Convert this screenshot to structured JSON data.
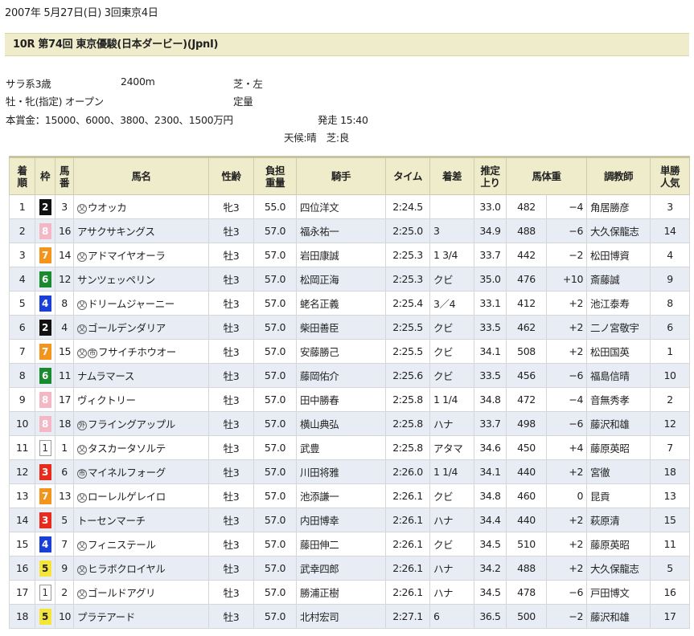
{
  "header": {
    "date": "2007年 5月27日(日) 3回東京4日",
    "race_title": "10R 第74回 東京優駿(日本ダービー)(JpnI)"
  },
  "info": {
    "category": "サラ系3歳",
    "distance": "2400m",
    "surface": "芝・左",
    "conditions": "牡・牝(指定) オープン",
    "weight_rule": "定量",
    "prize": "本賞金：15000、6000、3800、2300、1500万円",
    "post_time": "発走 15:40",
    "weather": "天候:晴　芝:良"
  },
  "table": {
    "headers": {
      "rank": "着\n順",
      "waku": "枠",
      "umaban": "馬\n番",
      "name": "馬名",
      "sexage": "性齢",
      "weight": "負担\n重量",
      "jockey": "騎手",
      "time": "タイム",
      "margin": "着差",
      "last3f": "推定\n上り",
      "body": "馬体重",
      "trainer": "調教師",
      "pop": "単勝\n人気"
    },
    "rows": [
      {
        "rank": "1",
        "waku": "2",
        "umaban": "3",
        "marks": [
          "父"
        ],
        "name": "ウオッカ",
        "sexage": "牝3",
        "weight": "55.0",
        "jockey": "四位洋文",
        "time": "2:24.5",
        "margin": "",
        "last3f": "33.0",
        "bw": "482",
        "bwd": "−4",
        "trainer": "角居勝彦",
        "pop": "3"
      },
      {
        "rank": "2",
        "waku": "8",
        "umaban": "16",
        "marks": [],
        "name": "アサクサキングス",
        "sexage": "牡3",
        "weight": "57.0",
        "jockey": "福永祐一",
        "time": "2:25.0",
        "margin": "3",
        "last3f": "34.9",
        "bw": "488",
        "bwd": "−6",
        "trainer": "大久保龍志",
        "pop": "14"
      },
      {
        "rank": "3",
        "waku": "7",
        "umaban": "14",
        "marks": [
          "父"
        ],
        "name": "アドマイヤオーラ",
        "sexage": "牡3",
        "weight": "57.0",
        "jockey": "岩田康誠",
        "time": "2:25.3",
        "margin": "1 3/4",
        "last3f": "33.7",
        "bw": "442",
        "bwd": "−2",
        "trainer": "松田博資",
        "pop": "4"
      },
      {
        "rank": "4",
        "waku": "6",
        "umaban": "12",
        "marks": [],
        "name": "サンツェッペリン",
        "sexage": "牡3",
        "weight": "57.0",
        "jockey": "松岡正海",
        "time": "2:25.3",
        "margin": "クビ",
        "last3f": "35.0",
        "bw": "476",
        "bwd": "+10",
        "trainer": "斎藤誠",
        "pop": "9"
      },
      {
        "rank": "5",
        "waku": "4",
        "umaban": "8",
        "marks": [
          "父"
        ],
        "name": "ドリームジャーニー",
        "sexage": "牡3",
        "weight": "57.0",
        "jockey": "蛯名正義",
        "time": "2:25.4",
        "margin": "3／4",
        "last3f": "33.1",
        "bw": "412",
        "bwd": "+2",
        "trainer": "池江泰寿",
        "pop": "8"
      },
      {
        "rank": "6",
        "waku": "2",
        "umaban": "4",
        "marks": [
          "父"
        ],
        "name": "ゴールデンダリア",
        "sexage": "牡3",
        "weight": "57.0",
        "jockey": "柴田善臣",
        "time": "2:25.5",
        "margin": "クビ",
        "last3f": "33.5",
        "bw": "462",
        "bwd": "+2",
        "trainer": "二ノ宮敬宇",
        "pop": "6"
      },
      {
        "rank": "7",
        "waku": "7",
        "umaban": "15",
        "marks": [
          "父",
          "市"
        ],
        "name": "フサイチホウオー",
        "sexage": "牡3",
        "weight": "57.0",
        "jockey": "安藤勝己",
        "time": "2:25.5",
        "margin": "クビ",
        "last3f": "34.1",
        "bw": "508",
        "bwd": "+2",
        "trainer": "松田国英",
        "pop": "1"
      },
      {
        "rank": "8",
        "waku": "6",
        "umaban": "11",
        "marks": [],
        "name": "ナムラマース",
        "sexage": "牡3",
        "weight": "57.0",
        "jockey": "藤岡佑介",
        "time": "2:25.6",
        "margin": "クビ",
        "last3f": "33.5",
        "bw": "456",
        "bwd": "−6",
        "trainer": "福島信晴",
        "pop": "10"
      },
      {
        "rank": "9",
        "waku": "8",
        "umaban": "17",
        "marks": [],
        "name": "ヴィクトリー",
        "sexage": "牡3",
        "weight": "57.0",
        "jockey": "田中勝春",
        "time": "2:25.8",
        "margin": "1 1/4",
        "last3f": "34.8",
        "bw": "472",
        "bwd": "−4",
        "trainer": "音無秀孝",
        "pop": "2"
      },
      {
        "rank": "10",
        "waku": "8",
        "umaban": "18",
        "marks": [
          "外"
        ],
        "name": "フライングアップル",
        "sexage": "牡3",
        "weight": "57.0",
        "jockey": "横山典弘",
        "time": "2:25.8",
        "margin": "ハナ",
        "last3f": "33.7",
        "bw": "498",
        "bwd": "−6",
        "trainer": "藤沢和雄",
        "pop": "12"
      },
      {
        "rank": "11",
        "waku": "1",
        "umaban": "1",
        "marks": [
          "父"
        ],
        "name": "タスカータソルテ",
        "sexage": "牡3",
        "weight": "57.0",
        "jockey": "武豊",
        "time": "2:25.8",
        "margin": "アタマ",
        "last3f": "34.6",
        "bw": "450",
        "bwd": "+4",
        "trainer": "藤原英昭",
        "pop": "7"
      },
      {
        "rank": "12",
        "waku": "3",
        "umaban": "6",
        "marks": [
          "市"
        ],
        "name": "マイネルフォーグ",
        "sexage": "牡3",
        "weight": "57.0",
        "jockey": "川田将雅",
        "time": "2:26.0",
        "margin": "1 1/4",
        "last3f": "34.1",
        "bw": "440",
        "bwd": "+2",
        "trainer": "宮徹",
        "pop": "18"
      },
      {
        "rank": "13",
        "waku": "7",
        "umaban": "13",
        "marks": [
          "父"
        ],
        "name": "ローレルゲレイロ",
        "sexage": "牡3",
        "weight": "57.0",
        "jockey": "池添謙一",
        "time": "2:26.1",
        "margin": "クビ",
        "last3f": "34.8",
        "bw": "460",
        "bwd": "0",
        "trainer": "昆貢",
        "pop": "13"
      },
      {
        "rank": "14",
        "waku": "3",
        "umaban": "5",
        "marks": [],
        "name": "トーセンマーチ",
        "sexage": "牡3",
        "weight": "57.0",
        "jockey": "内田博幸",
        "time": "2:26.1",
        "margin": "ハナ",
        "last3f": "34.4",
        "bw": "440",
        "bwd": "+2",
        "trainer": "萩原清",
        "pop": "15"
      },
      {
        "rank": "15",
        "waku": "4",
        "umaban": "7",
        "marks": [
          "父"
        ],
        "name": "フィニステール",
        "sexage": "牡3",
        "weight": "57.0",
        "jockey": "藤田伸二",
        "time": "2:26.1",
        "margin": "クビ",
        "last3f": "34.5",
        "bw": "510",
        "bwd": "+2",
        "trainer": "藤原英昭",
        "pop": "11"
      },
      {
        "rank": "16",
        "waku": "5",
        "umaban": "9",
        "marks": [
          "父"
        ],
        "name": "ヒラボクロイヤル",
        "sexage": "牡3",
        "weight": "57.0",
        "jockey": "武幸四郎",
        "time": "2:26.1",
        "margin": "ハナ",
        "last3f": "34.2",
        "bw": "488",
        "bwd": "+2",
        "trainer": "大久保龍志",
        "pop": "5"
      },
      {
        "rank": "17",
        "waku": "1",
        "umaban": "2",
        "marks": [
          "父"
        ],
        "name": "ゴールドアグリ",
        "sexage": "牡3",
        "weight": "57.0",
        "jockey": "勝浦正樹",
        "time": "2:26.1",
        "margin": "ハナ",
        "last3f": "34.5",
        "bw": "478",
        "bwd": "−6",
        "trainer": "戸田博文",
        "pop": "16"
      },
      {
        "rank": "18",
        "waku": "5",
        "umaban": "10",
        "marks": [],
        "name": "プラテアード",
        "sexage": "牡3",
        "weight": "57.0",
        "jockey": "北村宏司",
        "time": "2:27.1",
        "margin": "6",
        "last3f": "36.5",
        "bw": "500",
        "bwd": "−2",
        "trainer": "藤沢和雄",
        "pop": "17"
      }
    ]
  }
}
